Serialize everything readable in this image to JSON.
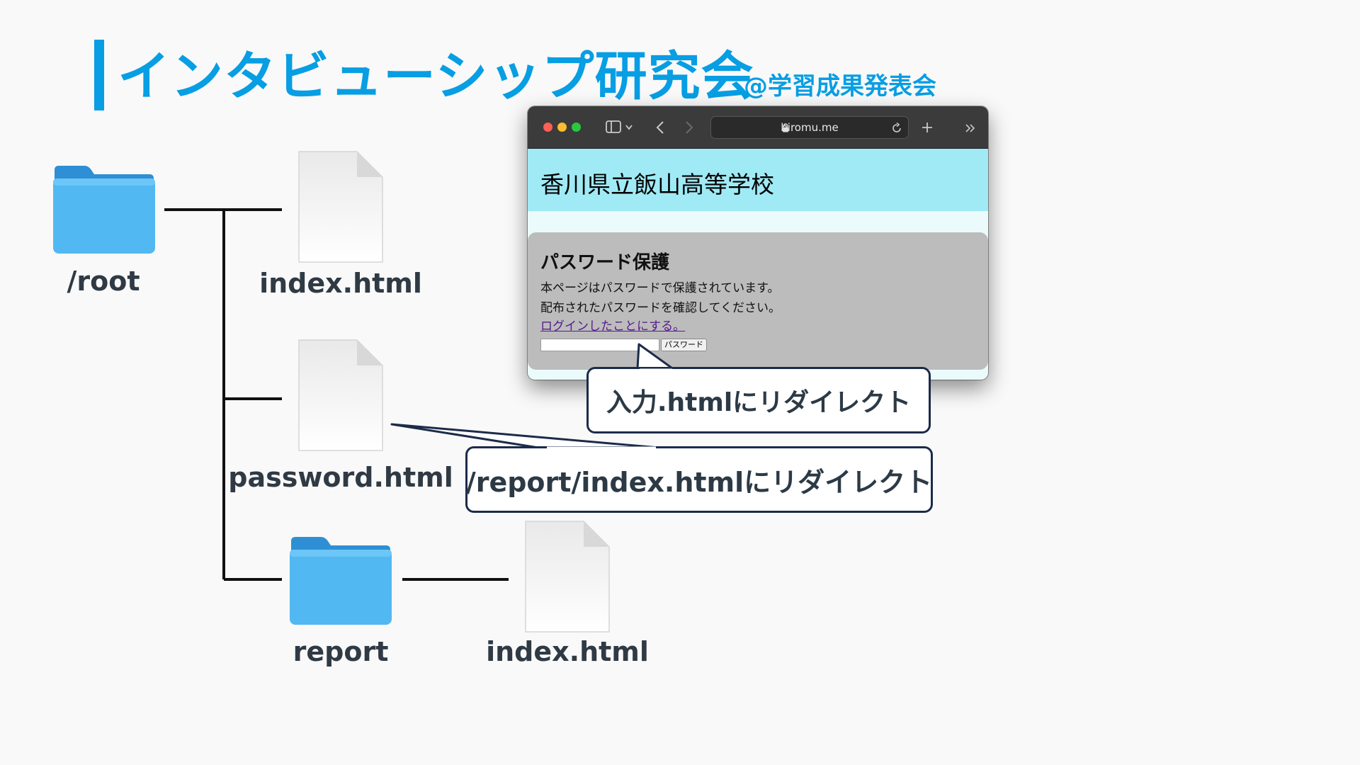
{
  "header": {
    "title": "インタビューシップ研究会",
    "subtitle": "@学習成果発表会"
  },
  "tree": {
    "root_label": "/root",
    "index_label": "index.html",
    "password_label": "password.html",
    "report_label": "report",
    "report_index_label": "index.html"
  },
  "browser": {
    "url": "hiromu.me",
    "site_title": "香川県立飯山高等学校",
    "pw_title": "パスワード保護",
    "pw_line1": "本ページはパスワードで保護されています。",
    "pw_line2": "配布されたパスワードを確認してください。",
    "pw_link": "ログインしたことにする。",
    "pw_button": "パスワード"
  },
  "callouts": {
    "redirect_input": "入力.htmlにリダイレクト",
    "redirect_report": "/report/index.htmlにリダイレクト"
  },
  "colors": {
    "accent": "#079ee3",
    "folder": "#4ab4f0",
    "site_header": "#a0eaf5",
    "pw_box": "#bcbcbc"
  }
}
